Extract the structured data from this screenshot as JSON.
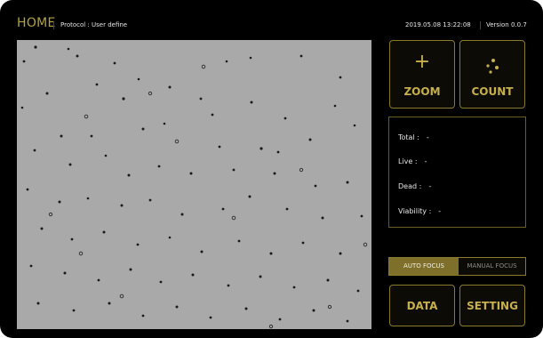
{
  "header": {
    "home_label": "HOME",
    "protocol": "Protocol : User define",
    "datetime": "2019.05.08 13:22:08",
    "version": "Version 0.0.7"
  },
  "buttons": {
    "zoom_label": "ZOOM",
    "zoom_icon": "+",
    "count_label": "COUNT",
    "data_label": "DATA",
    "setting_label": "SETTING"
  },
  "stats": {
    "total_label": "Total :",
    "total_value": "-",
    "live_label": "Live :",
    "live_value": "-",
    "dead_label": "Dead :",
    "dead_value": "-",
    "viability_label": "Viability :",
    "viability_value": "-"
  },
  "focus": {
    "auto_label": "AUTO FOCUS",
    "manual_label": "MANUAL FOCUS",
    "selected": "AUTO FOCUS"
  },
  "colors": {
    "accent": "#c7b04a",
    "accent_dark": "#8a7a2a",
    "selected_bg": "#7e6f2a",
    "image_bg": "#a9a9a9"
  },
  "icons": {
    "zoom": "plus-icon",
    "count": "cells-dots-icon"
  }
}
